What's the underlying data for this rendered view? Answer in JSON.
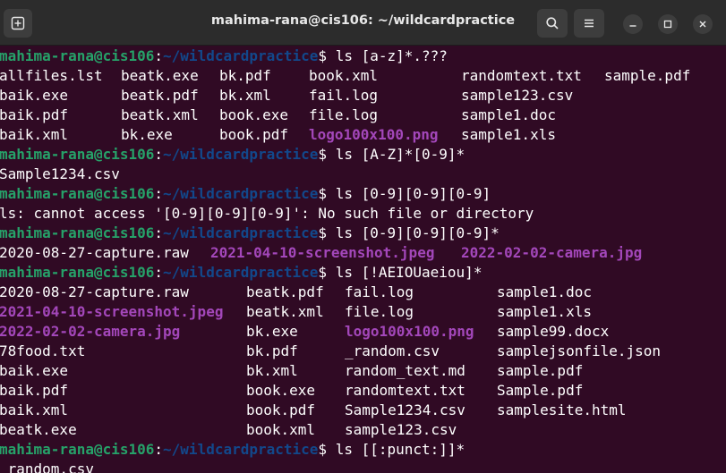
{
  "window": {
    "title": "mahima-rana@cis106: ~/wildcardpractice"
  },
  "icons": {
    "new_tab": "new-tab-icon",
    "search": "search-icon",
    "menu": "hamburger-menu-icon",
    "minimize": "minimize-icon",
    "maximize": "maximize-icon",
    "close": "close-icon"
  },
  "colors": {
    "background": "#300a24",
    "titlebar": "#2c2c2c",
    "user_host": "#26a269",
    "path": "#12488b",
    "image_file": "#a347ba",
    "text": "#ffffff"
  },
  "prompt": {
    "user_host": "mahima-rana@cis106",
    "colon": ":",
    "path": "~/wildcardpractice",
    "sigil": "$ "
  },
  "terminal": {
    "lines": [
      {
        "prompt": true,
        "command": "ls [a-z]*.???"
      },
      {
        "cells": [
          {
            "text": "allfiles.lst"
          },
          {
            "text": "beatk.exe"
          },
          {
            "text": "bk.pdf"
          },
          {
            "text": "book.xml"
          },
          {
            "text": "randomtext.txt"
          },
          {
            "text": "sample.pdf"
          }
        ]
      },
      {
        "cells": [
          {
            "text": "baik.exe"
          },
          {
            "text": "beatk.pdf"
          },
          {
            "text": "bk.xml"
          },
          {
            "text": "fail.log"
          },
          {
            "text": "sample123.csv"
          }
        ]
      },
      {
        "cells": [
          {
            "text": "baik.pdf"
          },
          {
            "text": "beatk.xml"
          },
          {
            "text": "book.exe"
          },
          {
            "text": "file.log"
          },
          {
            "text": "sample1.doc"
          }
        ]
      },
      {
        "cells": [
          {
            "text": "baik.xml"
          },
          {
            "text": "bk.exe"
          },
          {
            "text": "book.pdf"
          },
          {
            "text": "logo100x100.png",
            "kind": "image"
          },
          {
            "text": "sample1.xls"
          }
        ]
      },
      {
        "prompt": true,
        "command": "ls [A-Z]*[0-9]*"
      },
      {
        "cells": [
          {
            "text": "Sample1234.csv"
          }
        ]
      },
      {
        "prompt": true,
        "command": "ls [0-9][0-9][0-9]"
      },
      {
        "cells": [
          {
            "text": "ls: cannot access '[0-9][0-9][0-9]': No such file or directory"
          }
        ]
      },
      {
        "prompt": true,
        "command": "ls [0-9][0-9][0-9]*"
      },
      {
        "cells": [
          {
            "text": "2020-08-27-capture.raw"
          },
          {
            "text": "2021-04-10-screenshot.jpeg",
            "kind": "image"
          },
          {
            "text": "2022-02-02-camera.jpg",
            "kind": "image"
          }
        ]
      },
      {
        "prompt": true,
        "command": "ls [!AEIOUaeiou]*"
      },
      {
        "cells": [
          {
            "text": "2020-08-27-capture.raw"
          },
          {
            "text": "beatk.pdf"
          },
          {
            "text": "fail.log"
          },
          {
            "text": "sample1.doc"
          }
        ]
      },
      {
        "cells": [
          {
            "text": "2021-04-10-screenshot.jpeg",
            "kind": "image"
          },
          {
            "text": "beatk.xml"
          },
          {
            "text": "file.log"
          },
          {
            "text": "sample1.xls"
          }
        ]
      },
      {
        "cells": [
          {
            "text": "2022-02-02-camera.jpg",
            "kind": "image"
          },
          {
            "text": "bk.exe"
          },
          {
            "text": "logo100x100.png",
            "kind": "image"
          },
          {
            "text": "sample99.docx"
          }
        ]
      },
      {
        "cells": [
          {
            "text": "78food.txt"
          },
          {
            "text": "bk.pdf"
          },
          {
            "text": "_random.csv"
          },
          {
            "text": "samplejsonfile.json"
          }
        ]
      },
      {
        "cells": [
          {
            "text": "baik.exe"
          },
          {
            "text": "bk.xml"
          },
          {
            "text": "random_text.md"
          },
          {
            "text": "sample.pdf"
          }
        ]
      },
      {
        "cells": [
          {
            "text": "baik.pdf"
          },
          {
            "text": "book.exe"
          },
          {
            "text": "randomtext.txt"
          },
          {
            "text": "Sample.pdf"
          }
        ]
      },
      {
        "cells": [
          {
            "text": "baik.xml"
          },
          {
            "text": "book.pdf"
          },
          {
            "text": "Sample1234.csv"
          },
          {
            "text": "samplesite.html"
          }
        ]
      },
      {
        "cells": [
          {
            "text": "beatk.exe"
          },
          {
            "text": "book.xml"
          },
          {
            "text": "sample123.csv"
          }
        ]
      },
      {
        "prompt": true,
        "command": "ls [[:punct:]]*"
      },
      {
        "cells": [
          {
            "text": "_random.csv"
          }
        ]
      }
    ]
  }
}
